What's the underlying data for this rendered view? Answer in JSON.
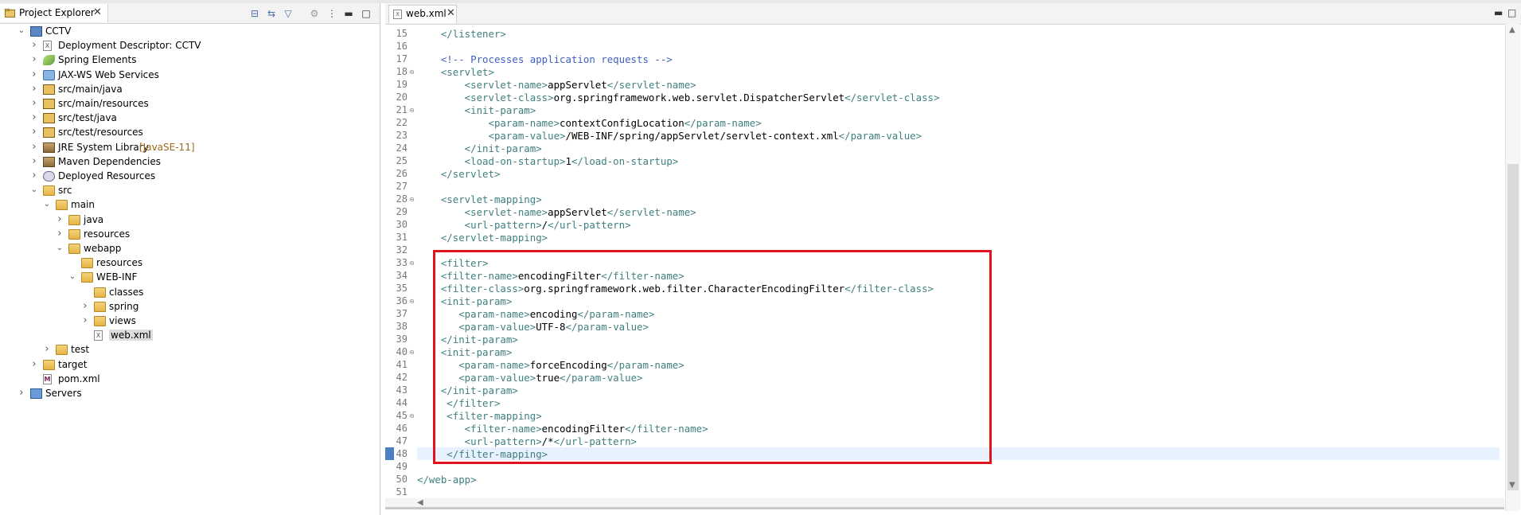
{
  "project_explorer": {
    "title": "Project Explorer",
    "tree": [
      {
        "label": "CCTV",
        "twisty": "open",
        "icon": "project-icon"
      },
      {
        "label": "Deployment Descriptor: CCTV",
        "twisty": "closed",
        "icon": "deployment-descriptor-icon"
      },
      {
        "label": "Spring Elements",
        "twisty": "closed",
        "icon": "spring-leaf-icon"
      },
      {
        "label": "JAX-WS Web Services",
        "twisty": "closed",
        "icon": "web-services-icon"
      },
      {
        "label": "src/main/java",
        "twisty": "closed",
        "icon": "source-folder-icon"
      },
      {
        "label": "src/main/resources",
        "twisty": "closed",
        "icon": "source-folder-icon"
      },
      {
        "label": "src/test/java",
        "twisty": "closed",
        "icon": "source-folder-icon"
      },
      {
        "label": "src/test/resources",
        "twisty": "closed",
        "icon": "source-folder-icon"
      },
      {
        "label": "JRE System Library",
        "decoration": "[JavaSE-11]",
        "twisty": "closed",
        "icon": "library-icon"
      },
      {
        "label": "Maven Dependencies",
        "twisty": "closed",
        "icon": "library-icon"
      },
      {
        "label": "Deployed Resources",
        "twisty": "closed",
        "icon": "deployed-resources-icon"
      },
      {
        "label": "src",
        "twisty": "open",
        "icon": "folder-icon"
      },
      {
        "label": "main",
        "twisty": "open",
        "icon": "folder-icon"
      },
      {
        "label": "java",
        "twisty": "closed",
        "icon": "folder-icon"
      },
      {
        "label": "resources",
        "twisty": "closed",
        "icon": "folder-icon"
      },
      {
        "label": "webapp",
        "twisty": "open",
        "icon": "folder-icon"
      },
      {
        "label": "resources",
        "twisty": "none",
        "icon": "folder-icon"
      },
      {
        "label": "WEB-INF",
        "twisty": "open",
        "icon": "folder-icon"
      },
      {
        "label": "classes",
        "twisty": "none",
        "icon": "folder-icon"
      },
      {
        "label": "spring",
        "twisty": "closed",
        "icon": "folder-icon"
      },
      {
        "label": "views",
        "twisty": "closed",
        "icon": "folder-icon"
      },
      {
        "label": "web.xml",
        "twisty": "none",
        "icon": "xml-file-icon",
        "selected": true
      },
      {
        "label": "test",
        "twisty": "closed",
        "icon": "folder-icon"
      },
      {
        "label": "target",
        "twisty": "closed",
        "icon": "folder-icon"
      },
      {
        "label": "pom.xml",
        "twisty": "none",
        "icon": "maven-pom-icon"
      },
      {
        "label": "Servers",
        "twisty": "closed",
        "icon": "servers-icon"
      }
    ]
  },
  "editor": {
    "tab_label": "web.xml",
    "current_line": 48,
    "lines": [
      {
        "n": 15,
        "fold": false,
        "segs": [
          {
            "c": "tag",
            "t": "    </listener>"
          }
        ]
      },
      {
        "n": 16,
        "fold": false,
        "segs": []
      },
      {
        "n": 17,
        "fold": false,
        "segs": [
          {
            "c": "cmt",
            "t": "    <!-- Processes application requests -->"
          }
        ]
      },
      {
        "n": 18,
        "fold": true,
        "segs": [
          {
            "c": "tag",
            "t": "    <servlet>"
          }
        ]
      },
      {
        "n": 19,
        "fold": false,
        "segs": [
          {
            "c": "tag",
            "t": "        <servlet-name>"
          },
          {
            "c": "txt",
            "t": "appServlet"
          },
          {
            "c": "tag",
            "t": "</servlet-name>"
          }
        ]
      },
      {
        "n": 20,
        "fold": false,
        "segs": [
          {
            "c": "tag",
            "t": "        <servlet-class>"
          },
          {
            "c": "txt",
            "t": "org.springframework.web.servlet.DispatcherServlet"
          },
          {
            "c": "tag",
            "t": "</servlet-class>"
          }
        ]
      },
      {
        "n": 21,
        "fold": true,
        "segs": [
          {
            "c": "tag",
            "t": "        <init-param>"
          }
        ]
      },
      {
        "n": 22,
        "fold": false,
        "segs": [
          {
            "c": "tag",
            "t": "            <param-name>"
          },
          {
            "c": "txt",
            "t": "contextConfigLocation"
          },
          {
            "c": "tag",
            "t": "</param-name>"
          }
        ]
      },
      {
        "n": 23,
        "fold": false,
        "segs": [
          {
            "c": "tag",
            "t": "            <param-value>"
          },
          {
            "c": "txt",
            "t": "/WEB-INF/spring/appServlet/servlet-context.xml"
          },
          {
            "c": "tag",
            "t": "</param-value>"
          }
        ]
      },
      {
        "n": 24,
        "fold": false,
        "segs": [
          {
            "c": "tag",
            "t": "        </init-param>"
          }
        ]
      },
      {
        "n": 25,
        "fold": false,
        "segs": [
          {
            "c": "tag",
            "t": "        <load-on-startup>"
          },
          {
            "c": "txt",
            "t": "1"
          },
          {
            "c": "tag",
            "t": "</load-on-startup>"
          }
        ]
      },
      {
        "n": 26,
        "fold": false,
        "segs": [
          {
            "c": "tag",
            "t": "    </servlet>"
          }
        ]
      },
      {
        "n": 27,
        "fold": false,
        "segs": []
      },
      {
        "n": 28,
        "fold": true,
        "segs": [
          {
            "c": "tag",
            "t": "    <servlet-mapping>"
          }
        ]
      },
      {
        "n": 29,
        "fold": false,
        "segs": [
          {
            "c": "tag",
            "t": "        <servlet-name>"
          },
          {
            "c": "txt",
            "t": "appServlet"
          },
          {
            "c": "tag",
            "t": "</servlet-name>"
          }
        ]
      },
      {
        "n": 30,
        "fold": false,
        "segs": [
          {
            "c": "tag",
            "t": "        <url-pattern>"
          },
          {
            "c": "txt",
            "t": "/"
          },
          {
            "c": "tag",
            "t": "</url-pattern>"
          }
        ]
      },
      {
        "n": 31,
        "fold": false,
        "segs": [
          {
            "c": "tag",
            "t": "    </servlet-mapping>"
          }
        ]
      },
      {
        "n": 32,
        "fold": false,
        "segs": []
      },
      {
        "n": 33,
        "fold": true,
        "segs": [
          {
            "c": "tag",
            "t": "    <filter>"
          }
        ]
      },
      {
        "n": 34,
        "fold": false,
        "segs": [
          {
            "c": "tag",
            "t": "    <filter-name>"
          },
          {
            "c": "txt",
            "t": "encodingFilter"
          },
          {
            "c": "tag",
            "t": "</filter-name>"
          }
        ]
      },
      {
        "n": 35,
        "fold": false,
        "segs": [
          {
            "c": "tag",
            "t": "    <filter-class>"
          },
          {
            "c": "txt",
            "t": "org.springframework.web.filter.CharacterEncodingFilter"
          },
          {
            "c": "tag",
            "t": "</filter-class>"
          }
        ]
      },
      {
        "n": 36,
        "fold": true,
        "segs": [
          {
            "c": "tag",
            "t": "    <init-param>"
          }
        ]
      },
      {
        "n": 37,
        "fold": false,
        "segs": [
          {
            "c": "tag",
            "t": "       <param-name>"
          },
          {
            "c": "txt",
            "t": "encoding"
          },
          {
            "c": "tag",
            "t": "</param-name>"
          }
        ]
      },
      {
        "n": 38,
        "fold": false,
        "segs": [
          {
            "c": "tag",
            "t": "       <param-value>"
          },
          {
            "c": "txt",
            "t": "UTF-8"
          },
          {
            "c": "tag",
            "t": "</param-value>"
          }
        ]
      },
      {
        "n": 39,
        "fold": false,
        "segs": [
          {
            "c": "tag",
            "t": "    </init-param>"
          }
        ]
      },
      {
        "n": 40,
        "fold": true,
        "segs": [
          {
            "c": "tag",
            "t": "    <init-param>"
          }
        ]
      },
      {
        "n": 41,
        "fold": false,
        "segs": [
          {
            "c": "tag",
            "t": "       <param-name>"
          },
          {
            "c": "txt",
            "t": "forceEncoding"
          },
          {
            "c": "tag",
            "t": "</param-name>"
          }
        ]
      },
      {
        "n": 42,
        "fold": false,
        "segs": [
          {
            "c": "tag",
            "t": "       <param-value>"
          },
          {
            "c": "txt",
            "t": "true"
          },
          {
            "c": "tag",
            "t": "</param-value>"
          }
        ]
      },
      {
        "n": 43,
        "fold": false,
        "segs": [
          {
            "c": "tag",
            "t": "    </init-param>"
          }
        ]
      },
      {
        "n": 44,
        "fold": false,
        "segs": [
          {
            "c": "tag",
            "t": "     </filter>"
          }
        ]
      },
      {
        "n": 45,
        "fold": true,
        "segs": [
          {
            "c": "tag",
            "t": "     <filter-mapping>"
          }
        ]
      },
      {
        "n": 46,
        "fold": false,
        "segs": [
          {
            "c": "tag",
            "t": "        <filter-name>"
          },
          {
            "c": "txt",
            "t": "encodingFilter"
          },
          {
            "c": "tag",
            "t": "</filter-name>"
          }
        ]
      },
      {
        "n": 47,
        "fold": false,
        "segs": [
          {
            "c": "tag",
            "t": "        <url-pattern>"
          },
          {
            "c": "txt",
            "t": "/*"
          },
          {
            "c": "tag",
            "t": "</url-pattern>"
          }
        ]
      },
      {
        "n": 48,
        "fold": false,
        "segs": [
          {
            "c": "tag",
            "t": "     </filter-mapping>"
          }
        ]
      },
      {
        "n": 49,
        "fold": false,
        "segs": []
      },
      {
        "n": 50,
        "fold": false,
        "segs": [
          {
            "c": "tag",
            "t": "</web-app>"
          }
        ]
      },
      {
        "n": 51,
        "fold": false,
        "segs": []
      }
    ]
  },
  "colors": {
    "tag": "#3f7f7f",
    "comment": "#3f5fbf",
    "text": "#000000",
    "highlight_box": "#e0141e",
    "current_line": "#e8f2fe"
  }
}
